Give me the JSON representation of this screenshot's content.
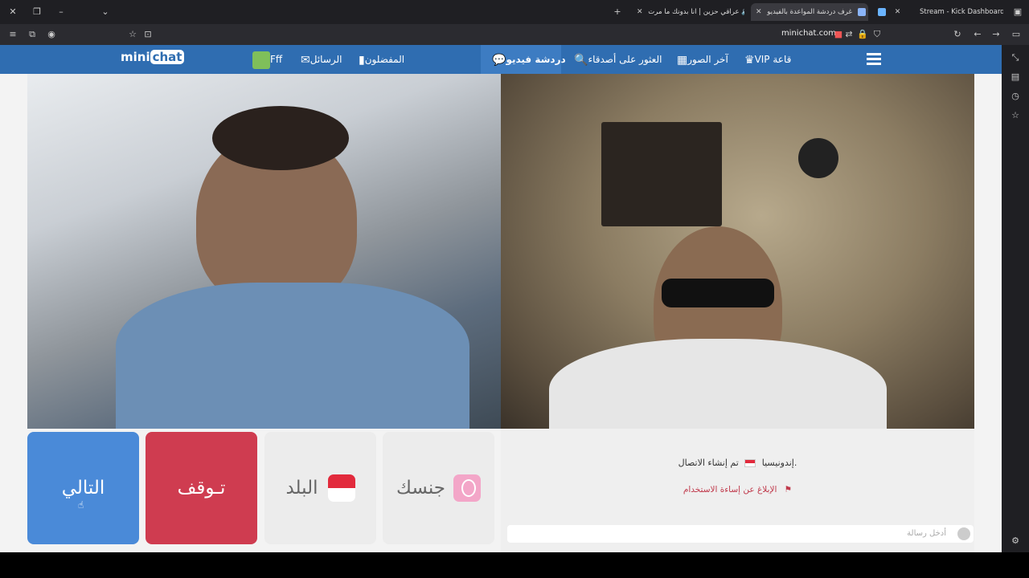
{
  "browser": {
    "tabs": [
      {
        "title": "Stream - Kick Dashboard",
        "fav_color": "#53fc18"
      },
      {
        "title": "",
        "fav_color": "#6ab4ff"
      },
      {
        "title": "غرف دردشة المواعدة بالفيديو",
        "fav_color": "#8ab4f8"
      },
      {
        "title": "عراقي حزين | انا بدونك ما مرت",
        "fav_color": "#ff0000"
      }
    ],
    "url": "minichat.com"
  },
  "nav": {
    "logo_mini": "mini",
    "logo_chat": "chat",
    "items": [
      {
        "label": "VIP قاعة",
        "icon": "crown-icon"
      },
      {
        "label": "آخر الصور",
        "icon": "grid-icon"
      },
      {
        "label": "العثور على أصدقاء",
        "icon": "search-icon"
      },
      {
        "label": "دردشة فيديو",
        "icon": "chat-bubble-icon"
      },
      {
        "label": "المفضلون",
        "icon": "bookmark-icon"
      },
      {
        "label": "الرسائل",
        "icon": "envelope-icon"
      },
      {
        "label": "Fff",
        "icon": "avatar"
      }
    ]
  },
  "controls": {
    "next": "التالي",
    "stop": "تـوقف",
    "country": "البلد",
    "gender": "جنسك"
  },
  "chat": {
    "status": "تم إنشاء الاتصال.",
    "country": "إندونيسيا",
    "report": "الإبلاغ عن إساءة الاستخدام",
    "placeholder": "أدخل رسالة"
  },
  "colors": {
    "nav": "#2f6db1",
    "next": "#4a8ad8",
    "stop": "#cf3c50",
    "report": "#c0394b"
  }
}
